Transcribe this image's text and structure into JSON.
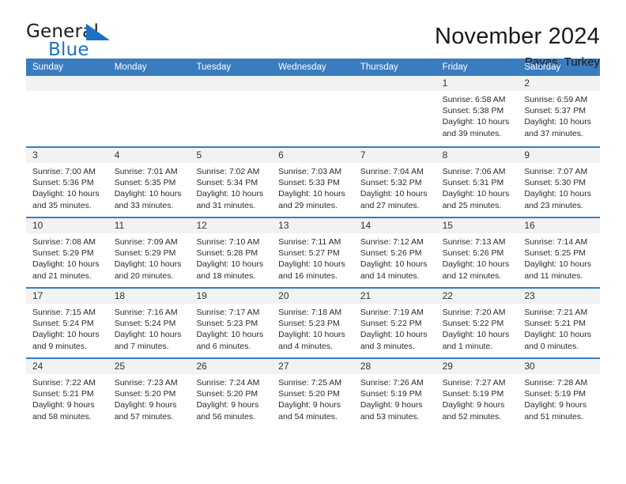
{
  "brand": {
    "name_part1": "General",
    "name_part2": "Blue",
    "accent_color": "#1a72c4"
  },
  "header": {
    "title": "November 2024",
    "location": "Payas, Turkey"
  },
  "theme": {
    "header_bar_color": "#3a7cc0",
    "date_band_color": "#f2f2f2"
  },
  "weekdays": [
    "Sunday",
    "Monday",
    "Tuesday",
    "Wednesday",
    "Thursday",
    "Friday",
    "Saturday"
  ],
  "weeks": [
    [
      {
        "day": "",
        "empty": true
      },
      {
        "day": "",
        "empty": true
      },
      {
        "day": "",
        "empty": true
      },
      {
        "day": "",
        "empty": true
      },
      {
        "day": "",
        "empty": true
      },
      {
        "day": "1",
        "sunrise": "Sunrise: 6:58 AM",
        "sunset": "Sunset: 5:38 PM",
        "daylight1": "Daylight: 10 hours",
        "daylight2": "and 39 minutes."
      },
      {
        "day": "2",
        "sunrise": "Sunrise: 6:59 AM",
        "sunset": "Sunset: 5:37 PM",
        "daylight1": "Daylight: 10 hours",
        "daylight2": "and 37 minutes."
      }
    ],
    [
      {
        "day": "3",
        "sunrise": "Sunrise: 7:00 AM",
        "sunset": "Sunset: 5:36 PM",
        "daylight1": "Daylight: 10 hours",
        "daylight2": "and 35 minutes."
      },
      {
        "day": "4",
        "sunrise": "Sunrise: 7:01 AM",
        "sunset": "Sunset: 5:35 PM",
        "daylight1": "Daylight: 10 hours",
        "daylight2": "and 33 minutes."
      },
      {
        "day": "5",
        "sunrise": "Sunrise: 7:02 AM",
        "sunset": "Sunset: 5:34 PM",
        "daylight1": "Daylight: 10 hours",
        "daylight2": "and 31 minutes."
      },
      {
        "day": "6",
        "sunrise": "Sunrise: 7:03 AM",
        "sunset": "Sunset: 5:33 PM",
        "daylight1": "Daylight: 10 hours",
        "daylight2": "and 29 minutes."
      },
      {
        "day": "7",
        "sunrise": "Sunrise: 7:04 AM",
        "sunset": "Sunset: 5:32 PM",
        "daylight1": "Daylight: 10 hours",
        "daylight2": "and 27 minutes."
      },
      {
        "day": "8",
        "sunrise": "Sunrise: 7:06 AM",
        "sunset": "Sunset: 5:31 PM",
        "daylight1": "Daylight: 10 hours",
        "daylight2": "and 25 minutes."
      },
      {
        "day": "9",
        "sunrise": "Sunrise: 7:07 AM",
        "sunset": "Sunset: 5:30 PM",
        "daylight1": "Daylight: 10 hours",
        "daylight2": "and 23 minutes."
      }
    ],
    [
      {
        "day": "10",
        "sunrise": "Sunrise: 7:08 AM",
        "sunset": "Sunset: 5:29 PM",
        "daylight1": "Daylight: 10 hours",
        "daylight2": "and 21 minutes."
      },
      {
        "day": "11",
        "sunrise": "Sunrise: 7:09 AM",
        "sunset": "Sunset: 5:29 PM",
        "daylight1": "Daylight: 10 hours",
        "daylight2": "and 20 minutes."
      },
      {
        "day": "12",
        "sunrise": "Sunrise: 7:10 AM",
        "sunset": "Sunset: 5:28 PM",
        "daylight1": "Daylight: 10 hours",
        "daylight2": "and 18 minutes."
      },
      {
        "day": "13",
        "sunrise": "Sunrise: 7:11 AM",
        "sunset": "Sunset: 5:27 PM",
        "daylight1": "Daylight: 10 hours",
        "daylight2": "and 16 minutes."
      },
      {
        "day": "14",
        "sunrise": "Sunrise: 7:12 AM",
        "sunset": "Sunset: 5:26 PM",
        "daylight1": "Daylight: 10 hours",
        "daylight2": "and 14 minutes."
      },
      {
        "day": "15",
        "sunrise": "Sunrise: 7:13 AM",
        "sunset": "Sunset: 5:26 PM",
        "daylight1": "Daylight: 10 hours",
        "daylight2": "and 12 minutes."
      },
      {
        "day": "16",
        "sunrise": "Sunrise: 7:14 AM",
        "sunset": "Sunset: 5:25 PM",
        "daylight1": "Daylight: 10 hours",
        "daylight2": "and 11 minutes."
      }
    ],
    [
      {
        "day": "17",
        "sunrise": "Sunrise: 7:15 AM",
        "sunset": "Sunset: 5:24 PM",
        "daylight1": "Daylight: 10 hours",
        "daylight2": "and 9 minutes."
      },
      {
        "day": "18",
        "sunrise": "Sunrise: 7:16 AM",
        "sunset": "Sunset: 5:24 PM",
        "daylight1": "Daylight: 10 hours",
        "daylight2": "and 7 minutes."
      },
      {
        "day": "19",
        "sunrise": "Sunrise: 7:17 AM",
        "sunset": "Sunset: 5:23 PM",
        "daylight1": "Daylight: 10 hours",
        "daylight2": "and 6 minutes."
      },
      {
        "day": "20",
        "sunrise": "Sunrise: 7:18 AM",
        "sunset": "Sunset: 5:23 PM",
        "daylight1": "Daylight: 10 hours",
        "daylight2": "and 4 minutes."
      },
      {
        "day": "21",
        "sunrise": "Sunrise: 7:19 AM",
        "sunset": "Sunset: 5:22 PM",
        "daylight1": "Daylight: 10 hours",
        "daylight2": "and 3 minutes."
      },
      {
        "day": "22",
        "sunrise": "Sunrise: 7:20 AM",
        "sunset": "Sunset: 5:22 PM",
        "daylight1": "Daylight: 10 hours",
        "daylight2": "and 1 minute."
      },
      {
        "day": "23",
        "sunrise": "Sunrise: 7:21 AM",
        "sunset": "Sunset: 5:21 PM",
        "daylight1": "Daylight: 10 hours",
        "daylight2": "and 0 minutes."
      }
    ],
    [
      {
        "day": "24",
        "sunrise": "Sunrise: 7:22 AM",
        "sunset": "Sunset: 5:21 PM",
        "daylight1": "Daylight: 9 hours",
        "daylight2": "and 58 minutes."
      },
      {
        "day": "25",
        "sunrise": "Sunrise: 7:23 AM",
        "sunset": "Sunset: 5:20 PM",
        "daylight1": "Daylight: 9 hours",
        "daylight2": "and 57 minutes."
      },
      {
        "day": "26",
        "sunrise": "Sunrise: 7:24 AM",
        "sunset": "Sunset: 5:20 PM",
        "daylight1": "Daylight: 9 hours",
        "daylight2": "and 56 minutes."
      },
      {
        "day": "27",
        "sunrise": "Sunrise: 7:25 AM",
        "sunset": "Sunset: 5:20 PM",
        "daylight1": "Daylight: 9 hours",
        "daylight2": "and 54 minutes."
      },
      {
        "day": "28",
        "sunrise": "Sunrise: 7:26 AM",
        "sunset": "Sunset: 5:19 PM",
        "daylight1": "Daylight: 9 hours",
        "daylight2": "and 53 minutes."
      },
      {
        "day": "29",
        "sunrise": "Sunrise: 7:27 AM",
        "sunset": "Sunset: 5:19 PM",
        "daylight1": "Daylight: 9 hours",
        "daylight2": "and 52 minutes."
      },
      {
        "day": "30",
        "sunrise": "Sunrise: 7:28 AM",
        "sunset": "Sunset: 5:19 PM",
        "daylight1": "Daylight: 9 hours",
        "daylight2": "and 51 minutes."
      }
    ]
  ]
}
